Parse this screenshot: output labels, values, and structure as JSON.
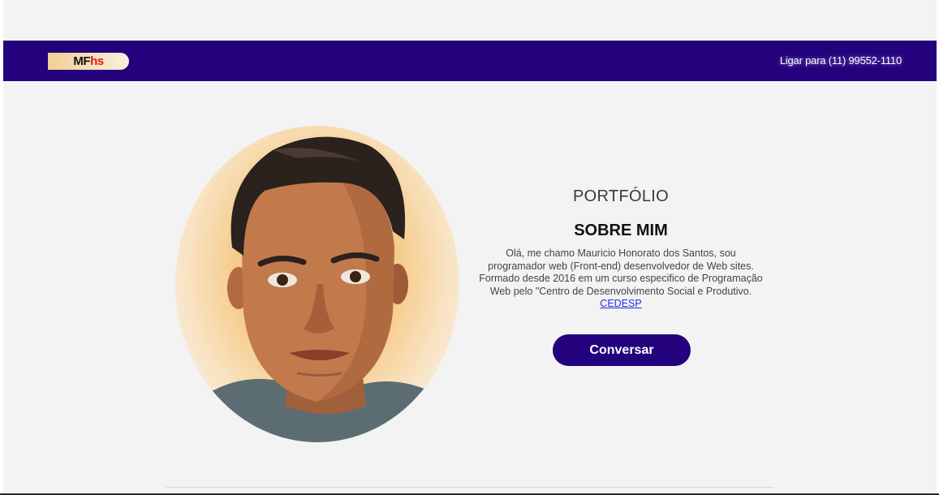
{
  "header": {
    "logo_left": "MF",
    "logo_right": "hs",
    "phone_label": "Ligar para (11) 99552-1110"
  },
  "about": {
    "eyebrow": "PORTFÓLIO",
    "title": "SOBRE MIM",
    "bio": "Olá, me chamo Mauricio Honorato dos Santos, sou programador web (Front-end) desenvolvedor de Web sites. Formado desde 2016 em um curso especifico de Programação Web pelo \"Centro de Desenvolvimento Social e Produtivo. ",
    "link_label": "CEDESP",
    "cta_label": "Conversar"
  },
  "colors": {
    "brand": "#24027e",
    "background": "#f3f3f3",
    "logo_accent": "#e01b1b"
  },
  "icons": {
    "portrait": "profile-portrait-image"
  }
}
